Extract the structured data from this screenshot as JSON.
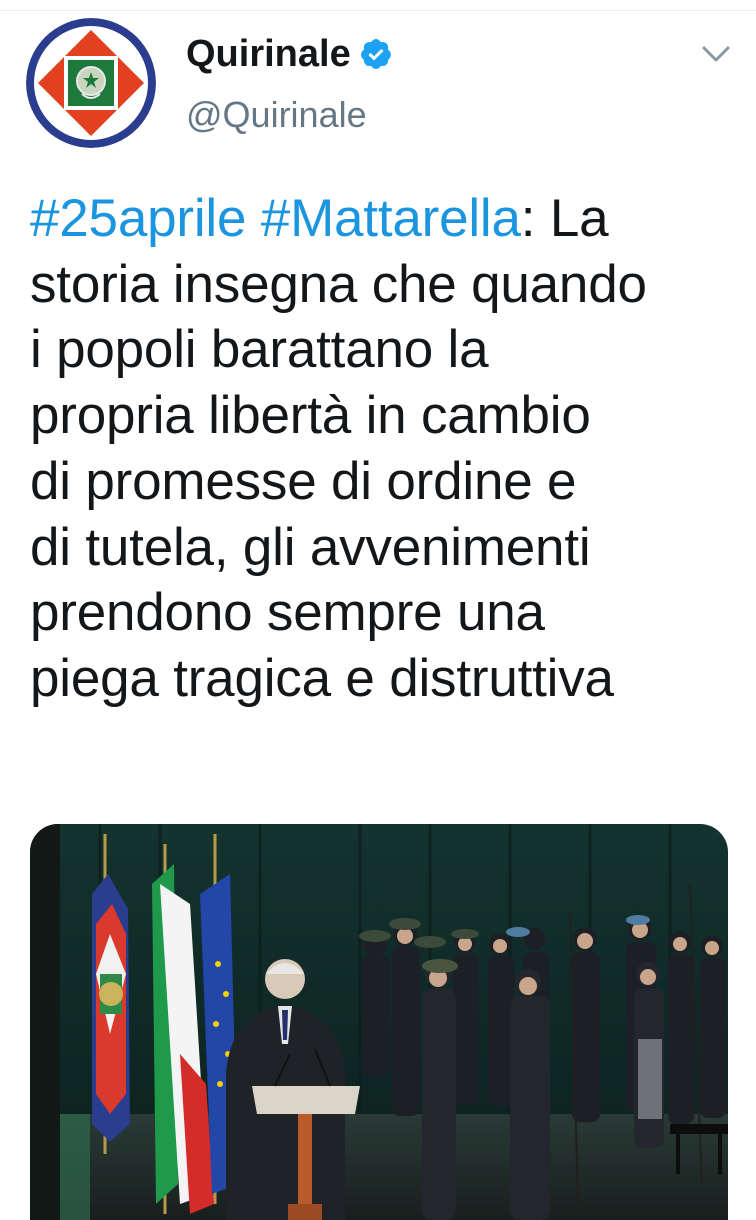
{
  "author": {
    "name": "Quirinale",
    "handle": "@Quirinale",
    "verified": true,
    "avatar_icon": "quirinale-standard-emblem"
  },
  "menu_icon": "chevron-down-icon",
  "tweet": {
    "hashtag_1": "#25aprile",
    "hashtag_2": "#Mattarella",
    "colon": ":",
    "line_1_rest": " La",
    "lines": [
      "storia insegna che quando",
      "i popoli barattano la",
      "propria libertà in cambio",
      "di promesse di ordine e",
      "di tutela, gli avvenimenti",
      "prendono sempre una",
      "piega tragica e distruttiva"
    ]
  },
  "colors": {
    "hashtag": "#1b95e0",
    "text": "#14171a",
    "secondary": "#657786",
    "verified": "#1da1f2"
  },
  "media": {
    "type": "photo"
  }
}
